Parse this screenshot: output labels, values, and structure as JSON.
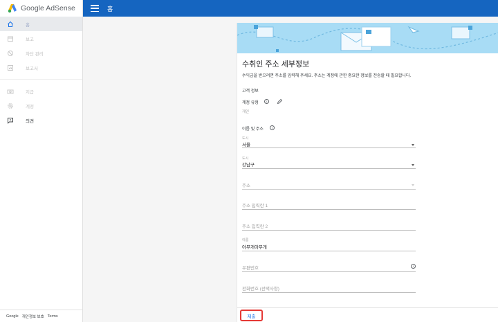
{
  "brand": {
    "name": "Google AdSense"
  },
  "topbar": {
    "title": "홈"
  },
  "sidebar": {
    "items": [
      {
        "label": "홈",
        "icon": "home-icon"
      },
      {
        "label": "보고",
        "icon": "calendar-icon"
      },
      {
        "label": "차단 관리",
        "icon": "block-icon"
      },
      {
        "label": "보고서",
        "icon": "report-icon"
      },
      {
        "label": "지급",
        "icon": "payments-icon"
      },
      {
        "label": "계정",
        "icon": "gear-icon"
      },
      {
        "label": "의견",
        "icon": "feedback-icon"
      }
    ],
    "footer": {
      "google": "Google",
      "privacy": "개인정보 보호",
      "terms": "Terms"
    }
  },
  "form": {
    "title": "수취인 주소 세부정보",
    "description": "수익금을 받으려면 주소를 입력해 주세요. 주소는 계정에 관한 중요한 정보를 전송할 때 필요합니다.",
    "customer_info": "고객 정보",
    "account_type_label": "계정 유형",
    "account_type_value": "개인",
    "name_address_label": "이름 및 주소",
    "city_label": "도시",
    "city_value": "서울",
    "district_label": "도시",
    "district_value": "강남구",
    "address_placeholder": "주소",
    "address_line1_placeholder": "주소 입력란 1",
    "address_line2_placeholder": "주소 입력란 2",
    "name_label": "이름",
    "name_value": "아무개아무개",
    "postal_code_placeholder": "우편번호",
    "phone_placeholder": "전화번호 (선택사항)",
    "submit_label": "제출"
  },
  "colors": {
    "topbar": "#1565c0",
    "hero": "#a8dcf5",
    "submit_text": "#1a73e8",
    "highlight_border": "#e53935"
  }
}
